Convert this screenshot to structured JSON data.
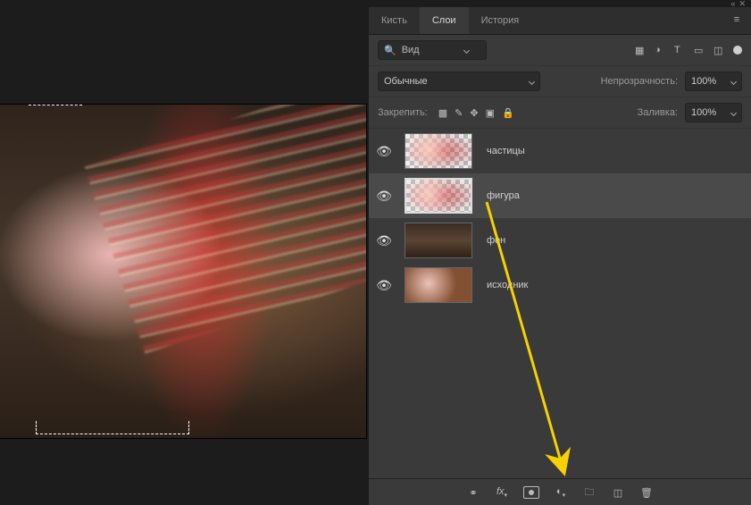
{
  "panel": {
    "tabs": [
      "Кисть",
      "Слои",
      "История"
    ],
    "active_tab": "Слои",
    "search": {
      "placeholder": "Вид"
    },
    "blend_mode": "Обычные",
    "opacity_label": "Непрозрачность:",
    "opacity_value": "100%",
    "lock_label": "Закрепить:",
    "fill_label": "Заливка:",
    "fill_value": "100%",
    "layers": [
      {
        "name": "частицы",
        "visible": true,
        "thumb": "checker",
        "active": false
      },
      {
        "name": "фигура",
        "visible": true,
        "thumb": "checker",
        "active": true
      },
      {
        "name": "фон",
        "visible": true,
        "thumb": "solid",
        "active": false
      },
      {
        "name": "исходник",
        "visible": true,
        "thumb": "src",
        "active": false
      }
    ],
    "bottom_icons": [
      "link-icon",
      "fx-icon",
      "layer-mask-icon",
      "adjustment-icon",
      "group-icon",
      "new-layer-icon",
      "trash-icon"
    ]
  }
}
